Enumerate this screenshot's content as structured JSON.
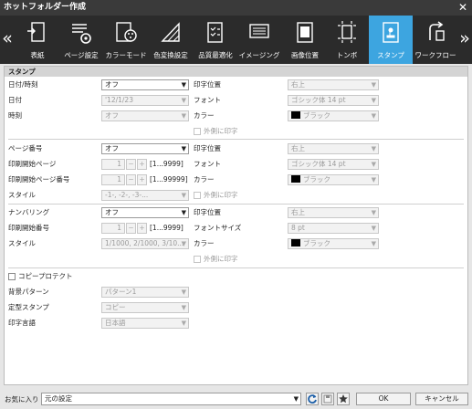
{
  "window": {
    "title": "ホットフォルダー作成"
  },
  "toolbar": {
    "prev": "«",
    "next": "»",
    "tabs": [
      {
        "label": "表紙",
        "icon": "cover-icon"
      },
      {
        "label": "ページ設定",
        "icon": "page-setup-icon"
      },
      {
        "label": "カラーモード",
        "icon": "color-mode-icon"
      },
      {
        "label": "色変換設定",
        "icon": "color-conversion-icon"
      },
      {
        "label": "品質最適化",
        "icon": "quality-icon"
      },
      {
        "label": "イメージング",
        "icon": "imaging-icon"
      },
      {
        "label": "画像位置",
        "icon": "image-position-icon"
      },
      {
        "label": "トンボ",
        "icon": "crop-marks-icon"
      },
      {
        "label": "スタンプ",
        "icon": "stamp-icon",
        "active": true
      },
      {
        "label": "ワークフロー",
        "icon": "workflow-icon"
      }
    ]
  },
  "section": {
    "title": "スタンプ"
  },
  "datetime": {
    "label": "日付/時刻",
    "value": "オフ",
    "date_label": "日付",
    "date_value": "'12/1/23",
    "time_label": "時刻",
    "time_value": "オフ",
    "pos_label": "印字位置",
    "pos_value": "右上",
    "font_label": "フォント",
    "font_value": "ゴシック体 14 pt",
    "color_label": "カラー",
    "color_value": "ブラック",
    "outside_label": "外側に印字"
  },
  "page": {
    "label": "ページ番号",
    "value": "オフ",
    "start_page_label": "印刷開始ページ",
    "start_page_value": "1",
    "start_page_range": "[1...9999]",
    "start_num_label": "印刷開始ページ番号",
    "start_num_value": "1",
    "start_num_range": "[1...99999]",
    "style_label": "スタイル",
    "style_value": "-1-, -2-, -3-...",
    "pos_label": "印字位置",
    "pos_value": "右上",
    "font_label": "フォント",
    "font_value": "ゴシック体 14 pt",
    "color_label": "カラー",
    "color_value": "ブラック",
    "outside_label": "外側に印字"
  },
  "numbering": {
    "label": "ナンバリング",
    "value": "オフ",
    "start_label": "印刷開始番号",
    "start_value": "1",
    "start_range": "[1...9999]",
    "style_label": "スタイル",
    "style_value": "1/1000, 2/1000, 3/10...",
    "pos_label": "印字位置",
    "pos_value": "右上",
    "size_label": "フォントサイズ",
    "size_value": "8 pt",
    "color_label": "カラー",
    "color_value": "ブラック",
    "outside_label": "外側に印字"
  },
  "copy": {
    "label": "コピープロテクト",
    "bg_label": "背景パターン",
    "bg_value": "パターン1",
    "stamp_label": "定型スタンプ",
    "stamp_value": "コピー",
    "lang_label": "印字言語",
    "lang_value": "日本語"
  },
  "spin": {
    "minus": "−",
    "plus": "+"
  },
  "footer": {
    "fav_label": "お気に入り",
    "fav_value": "元の設定",
    "ok": "OK",
    "cancel": "キャンセル"
  }
}
